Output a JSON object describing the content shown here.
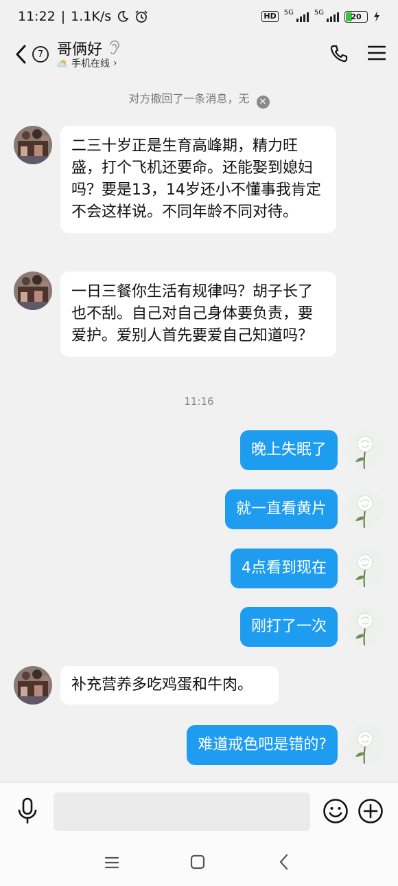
{
  "status_bar": {
    "time": "11:22",
    "speed": "1.1K/s",
    "hd": "HD",
    "net1": "5G",
    "net2": "5G",
    "battery": "20"
  },
  "header": {
    "unread_count": "7",
    "contact_name": "哥俩好",
    "status": "手机在线",
    "status_chevron": "›"
  },
  "system_note": "对方撤回了一条消息，无",
  "timestamp": "11:16",
  "messages": [
    {
      "side": "in",
      "text": "二三十岁正是生育高峰期，精力旺盛，打个飞机还要命。还能娶到媳妇吗？要是13，14岁还小不懂事我肯定不会这样说。不同年龄不同对待。"
    },
    {
      "side": "in",
      "text": "一日三餐你生活有规律吗？胡子长了也不刮。自己对自己身体要负责，要爱护。爱别人首先要爱自己知道吗？"
    },
    {
      "side": "out",
      "text": "晚上失眠了"
    },
    {
      "side": "out",
      "text": "就一直看黄片"
    },
    {
      "side": "out",
      "text": "4点看到现在"
    },
    {
      "side": "out",
      "text": "刚打了一次"
    },
    {
      "side": "in",
      "text": "补充营养多吃鸡蛋和牛肉。"
    },
    {
      "side": "out",
      "text": "难道戒色吧是错的?"
    }
  ],
  "input": {
    "placeholder": ""
  },
  "colors": {
    "outgoing_bubble": "#1e9df0",
    "incoming_bubble": "#ffffff",
    "background": "#f1f1f1",
    "battery_fill": "#3cc43c"
  }
}
